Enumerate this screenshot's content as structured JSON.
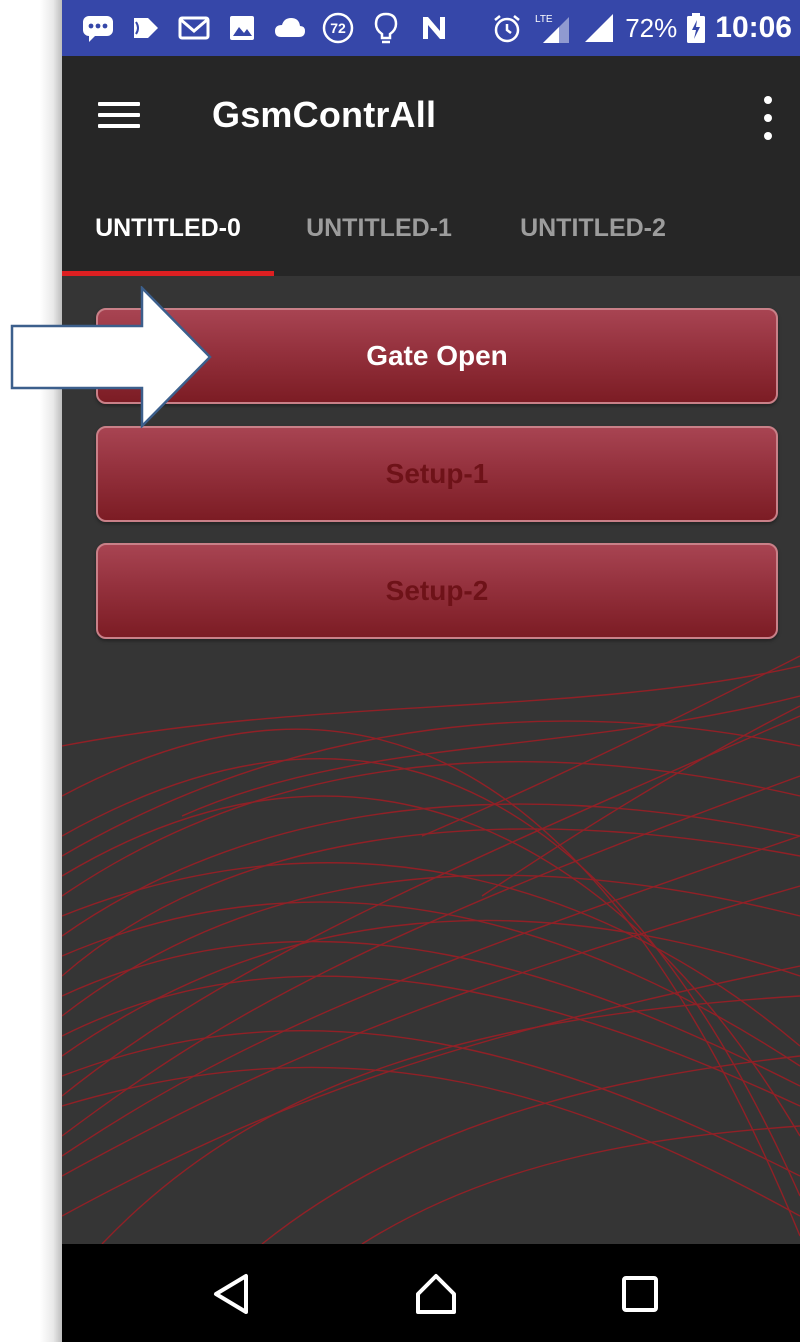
{
  "status_bar": {
    "icons": [
      "message-icon",
      "notification-icon",
      "gmail-icon",
      "image-icon",
      "cloud-icon",
      "badge-72-icon",
      "lightbulb-icon",
      "n-icon"
    ],
    "badge_value": "72",
    "lte_label": "LTE",
    "battery_percent": "72%",
    "time": "10:06"
  },
  "app_bar": {
    "title": "GsmContrAll"
  },
  "tabs": [
    {
      "label": "UNTITLED-0",
      "active": true
    },
    {
      "label": "UNTITLED-1",
      "active": false
    },
    {
      "label": "UNTITLED-2",
      "active": false
    }
  ],
  "buttons": {
    "gate_open": "Gate Open",
    "setup_1": "Setup-1",
    "setup_2": "Setup-2"
  },
  "colors": {
    "status_bar": "#3647a9",
    "app_bar": "#262626",
    "tab_indicator": "#dd1f21",
    "button_red": "#94313d",
    "background": "#353535",
    "callout_arrow": "#3c5f8c"
  }
}
